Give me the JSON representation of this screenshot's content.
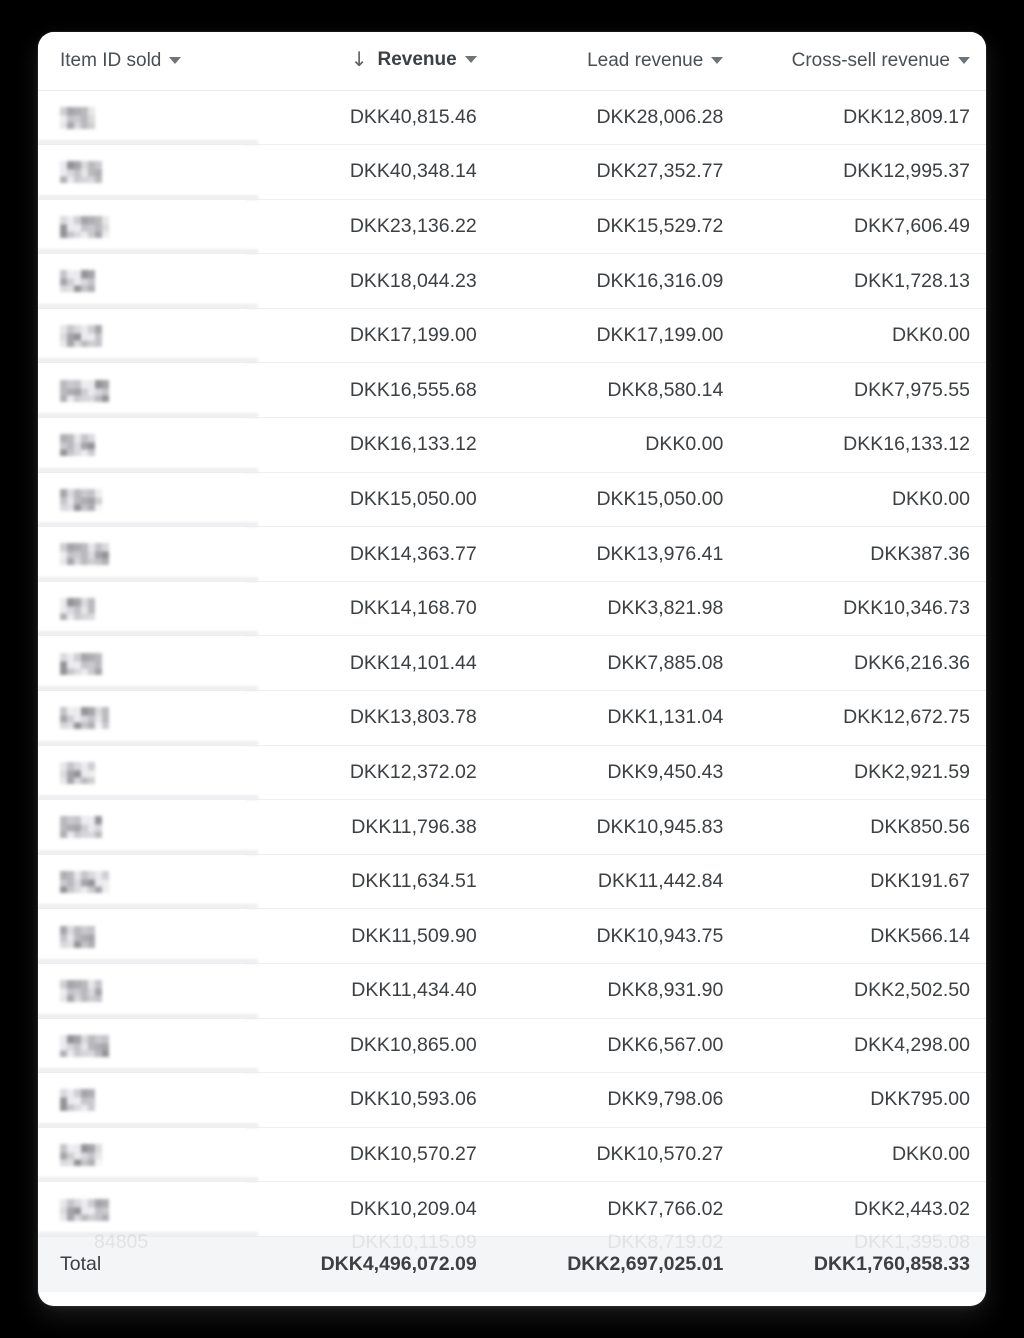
{
  "table": {
    "columns": [
      {
        "key": "item_id",
        "label": "Item ID sold",
        "align": "left",
        "sorted": false,
        "sort_direction": "",
        "has_menu": true
      },
      {
        "key": "revenue",
        "label": "Revenue",
        "align": "right",
        "sorted": true,
        "sort_direction": "descending",
        "sort_icon": "arrow-down-icon",
        "has_menu": true
      },
      {
        "key": "lead",
        "label": "Lead revenue",
        "align": "right",
        "sorted": false,
        "sort_direction": "",
        "has_menu": true
      },
      {
        "key": "crosssell",
        "label": "Cross-sell revenue",
        "align": "right",
        "sorted": false,
        "sort_direction": "",
        "has_menu": true
      }
    ],
    "currency_prefix": "DKK",
    "id_column_state": "redacted",
    "rows": [
      {
        "item_id": "",
        "revenue": "DKK40,815.46",
        "lead": "DKK28,006.28",
        "crosssell": "DKK12,809.17"
      },
      {
        "item_id": "",
        "revenue": "DKK40,348.14",
        "lead": "DKK27,352.77",
        "crosssell": "DKK12,995.37"
      },
      {
        "item_id": "",
        "revenue": "DKK23,136.22",
        "lead": "DKK15,529.72",
        "crosssell": "DKK7,606.49"
      },
      {
        "item_id": "",
        "revenue": "DKK18,044.23",
        "lead": "DKK16,316.09",
        "crosssell": "DKK1,728.13"
      },
      {
        "item_id": "",
        "revenue": "DKK17,199.00",
        "lead": "DKK17,199.00",
        "crosssell": "DKK0.00"
      },
      {
        "item_id": "",
        "revenue": "DKK16,555.68",
        "lead": "DKK8,580.14",
        "crosssell": "DKK7,975.55"
      },
      {
        "item_id": "",
        "revenue": "DKK16,133.12",
        "lead": "DKK0.00",
        "crosssell": "DKK16,133.12"
      },
      {
        "item_id": "",
        "revenue": "DKK15,050.00",
        "lead": "DKK15,050.00",
        "crosssell": "DKK0.00"
      },
      {
        "item_id": "",
        "revenue": "DKK14,363.77",
        "lead": "DKK13,976.41",
        "crosssell": "DKK387.36"
      },
      {
        "item_id": "",
        "revenue": "DKK14,168.70",
        "lead": "DKK3,821.98",
        "crosssell": "DKK10,346.73"
      },
      {
        "item_id": "",
        "revenue": "DKK14,101.44",
        "lead": "DKK7,885.08",
        "crosssell": "DKK6,216.36"
      },
      {
        "item_id": "",
        "revenue": "DKK13,803.78",
        "lead": "DKK1,131.04",
        "crosssell": "DKK12,672.75"
      },
      {
        "item_id": "",
        "revenue": "DKK12,372.02",
        "lead": "DKK9,450.43",
        "crosssell": "DKK2,921.59"
      },
      {
        "item_id": "",
        "revenue": "DKK11,796.38",
        "lead": "DKK10,945.83",
        "crosssell": "DKK850.56"
      },
      {
        "item_id": "",
        "revenue": "DKK11,634.51",
        "lead": "DKK11,442.84",
        "crosssell": "DKK191.67"
      },
      {
        "item_id": "",
        "revenue": "DKK11,509.90",
        "lead": "DKK10,943.75",
        "crosssell": "DKK566.14"
      },
      {
        "item_id": "",
        "revenue": "DKK11,434.40",
        "lead": "DKK8,931.90",
        "crosssell": "DKK2,502.50"
      },
      {
        "item_id": "",
        "revenue": "DKK10,865.00",
        "lead": "DKK6,567.00",
        "crosssell": "DKK4,298.00"
      },
      {
        "item_id": "",
        "revenue": "DKK10,593.06",
        "lead": "DKK9,798.06",
        "crosssell": "DKK795.00"
      },
      {
        "item_id": "",
        "revenue": "DKK10,570.27",
        "lead": "DKK10,570.27",
        "crosssell": "DKK0.00"
      },
      {
        "item_id": "",
        "revenue": "DKK10,209.04",
        "lead": "DKK7,766.02",
        "crosssell": "DKK2,443.02"
      }
    ],
    "total": {
      "label": "Total",
      "revenue": "DKK4,496,072.09",
      "lead": "DKK2,697,025.01",
      "crosssell": "DKK1,760,858.33"
    },
    "partially_hidden_next_row": {
      "item_id": "84805",
      "revenue": "DKK10,115.09",
      "lead": "DKK8,719.02",
      "crosssell": "DKK1,395.08"
    }
  },
  "icons": {
    "sort_desc": "arrow-down-icon",
    "column_menu": "chevron-down-icon"
  },
  "colors": {
    "page_background": "#000000",
    "card_background": "#ffffff",
    "text_primary": "#3c4043",
    "text_header": "#4a4f53",
    "row_divider": "#eceef0",
    "total_row_background": "#f4f5f6"
  }
}
